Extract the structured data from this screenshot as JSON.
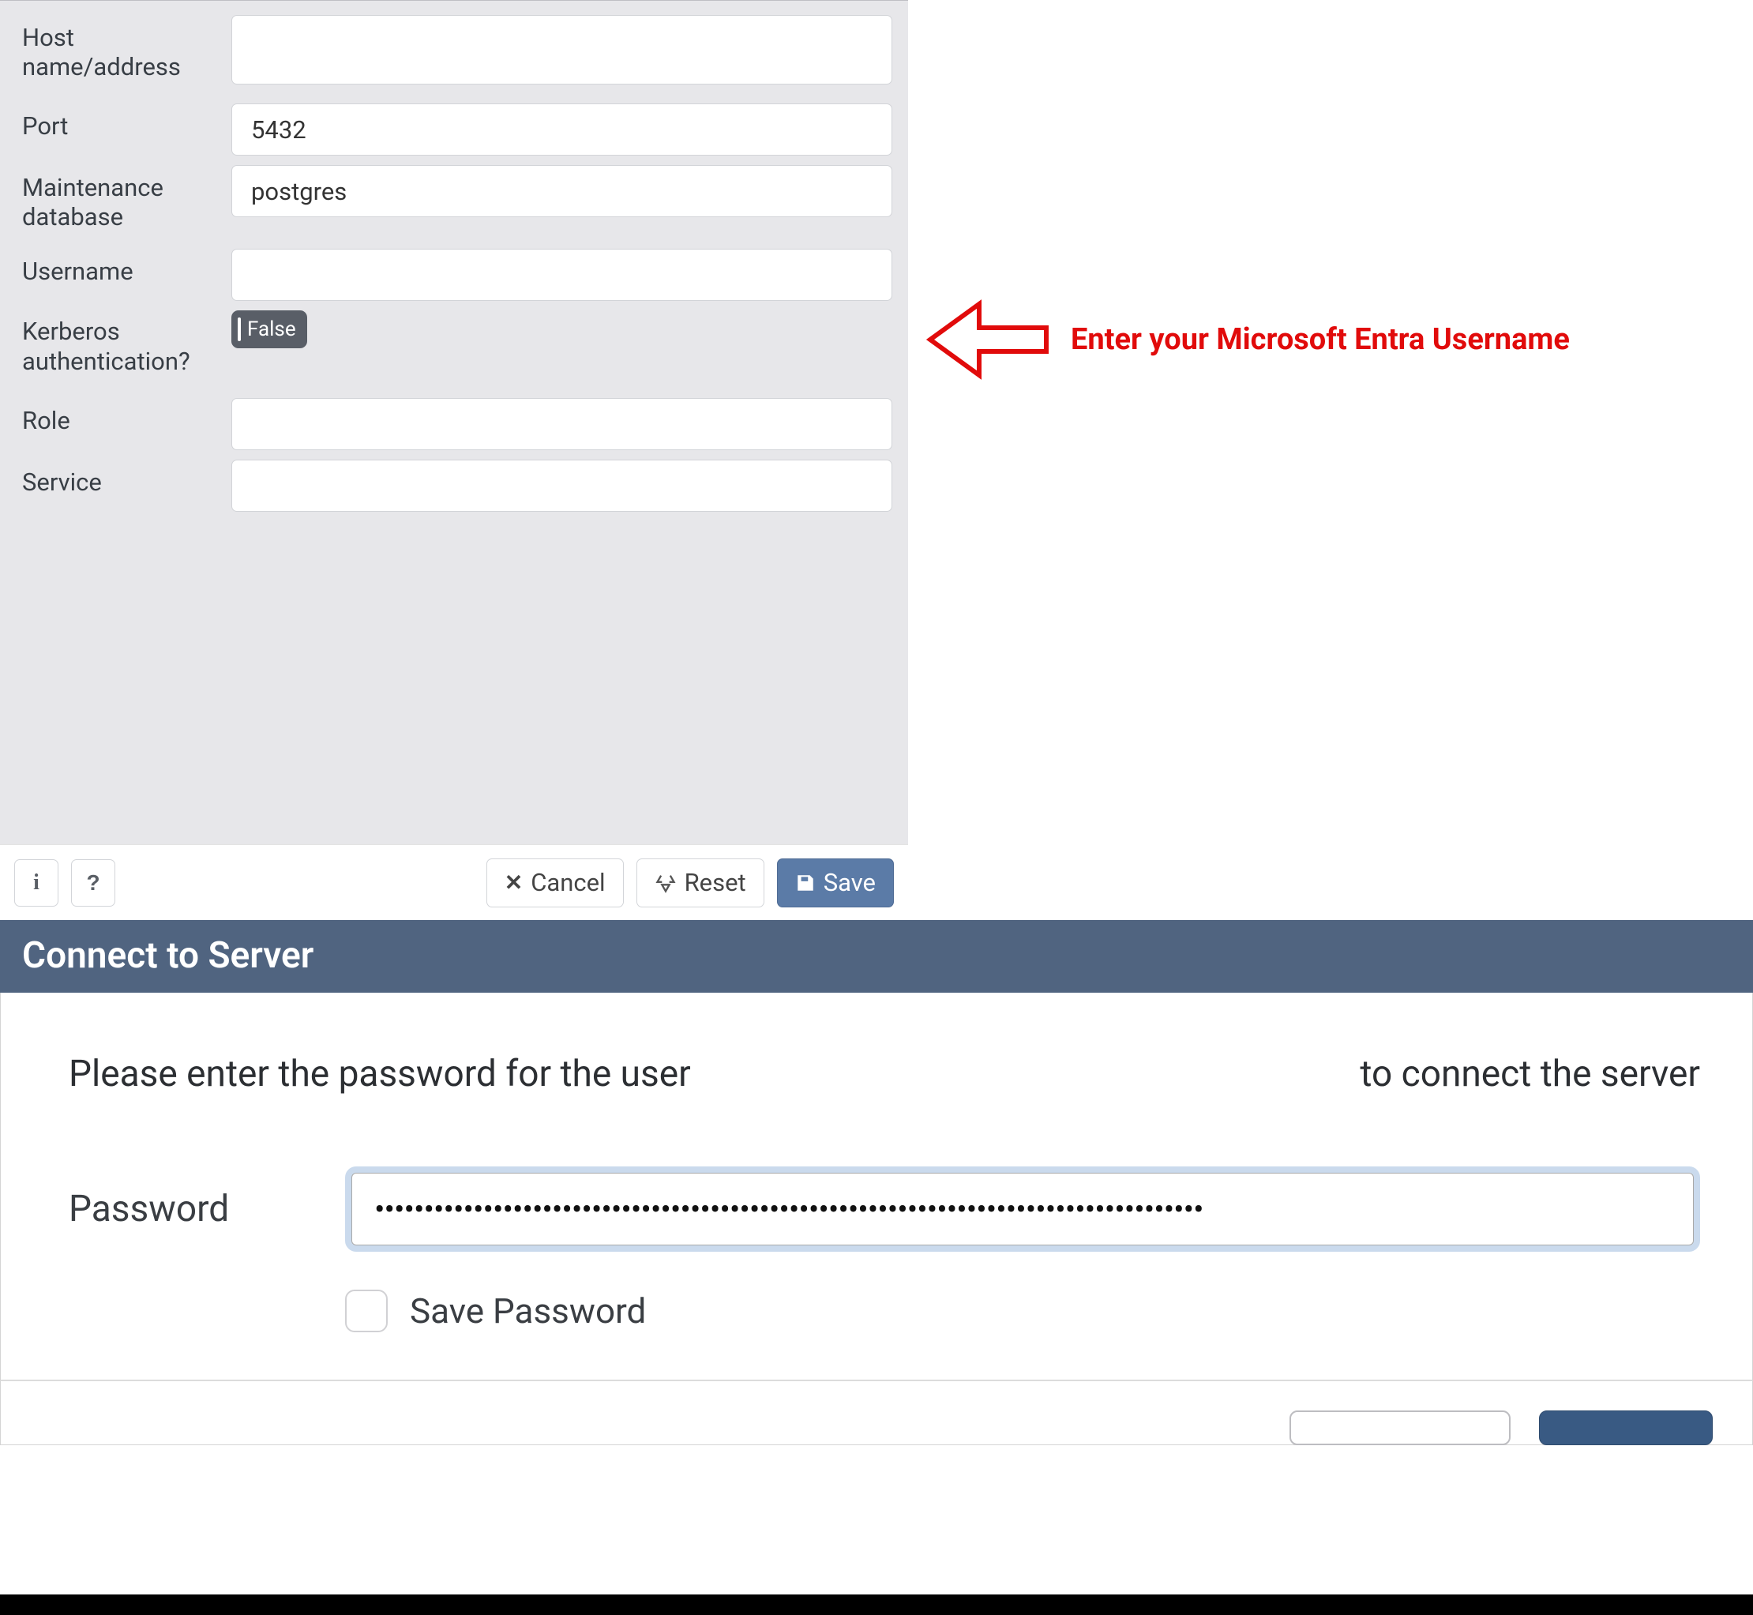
{
  "form": {
    "host_label": "Host name/address",
    "host_value": "",
    "port_label": "Port",
    "port_value": "5432",
    "maintdb_label": "Maintenance database",
    "maintdb_value": "postgres",
    "username_label": "Username",
    "username_value": "",
    "kerberos_label": "Kerberos authentication?",
    "kerberos_value": "False",
    "role_label": "Role",
    "role_value": "",
    "service_label": "Service",
    "service_value": ""
  },
  "buttons": {
    "info": "i",
    "help": "?",
    "cancel": "Cancel",
    "reset": "Reset",
    "save": "Save"
  },
  "annotation": {
    "text": "Enter your Microsoft Entra Username"
  },
  "dialog": {
    "title": "Connect to Server",
    "prompt_left": "Please enter the password for the user",
    "prompt_right": "to connect the server",
    "password_label": "Password",
    "password_value": "••••••••••••••••••••••••••••••••••••••••••••••••••••••••••••••••••••••••••••••••••••",
    "save_password_label": "Save Password"
  }
}
